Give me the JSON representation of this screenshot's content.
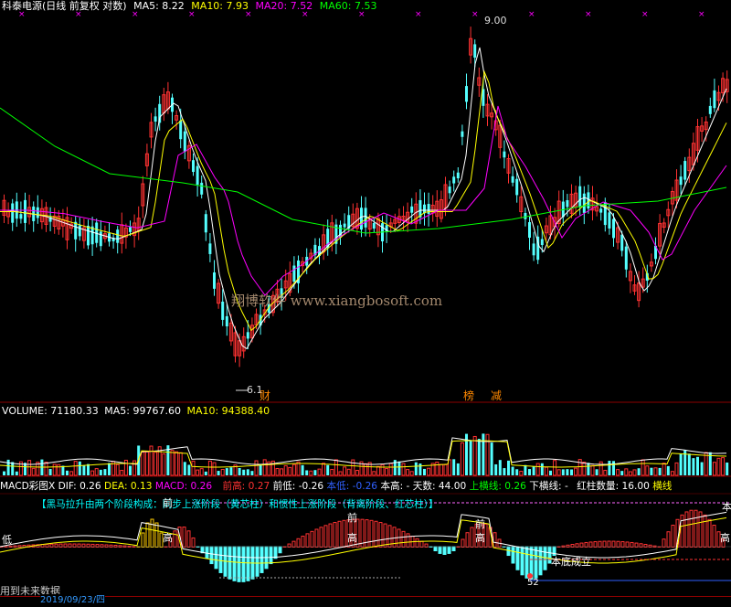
{
  "header": {
    "title": "科泰电源(日线 前复权 对数)",
    "ma5_label": "MA5: 8.22",
    "ma10_label": "MA10: 7.93",
    "ma20_label": "MA20: 7.52",
    "ma60_label": "MA60: 7.53",
    "high_price_label": "9.00",
    "low_price_label": "6.1",
    "badge_cai": "财",
    "badge_bang": "榜",
    "badge_jian": "减",
    "watermark": "翔博软件 www.xiangbosoft.com"
  },
  "volume_panel": {
    "volume_label": "VOLUME: 71180.33",
    "ma5_label": "MA5: 99767.60",
    "ma10_label": "MA10: 94388.40"
  },
  "macd_panel": {
    "name": "MACD彩图X",
    "dif": "DIF: 0.26",
    "dea": "DEA: 0.13",
    "macd": "MACD: 0.26",
    "qian_gao": "前高: 0.27",
    "qian_di": "前低: -0.26",
    "ben_di": "本低: -0.26",
    "ben_gao_days": "本高: - 天数: 44.00",
    "shang_heng": "上横线: 0.26",
    "xia_heng": "下横线: -",
    "hong_zhu": "红柱数量: 16.00",
    "heng_xian": "横线",
    "description": "【黑马拉升由两个阶段构成：同步上涨阶段（黄芯柱）和惯性上涨阶段（背离阶段、红芯柱）】",
    "label_gao1": "高",
    "label_gao2": "高",
    "label_gao3": "高",
    "label_gao4": "高",
    "label_qian1": "前",
    "label_qian2": "前",
    "label_qian3": "前",
    "label_ben": "本",
    "label_di": "低",
    "label_ben_di_cheng_li": "本底成立",
    "label_52": "52"
  },
  "footer": {
    "future_data": "用到未来数据",
    "date": "2019/09/23/四"
  },
  "colors": {
    "up": "#ff3232",
    "down": "#54ffff",
    "ma5": "#ffffff",
    "ma10": "#ffff00",
    "ma20": "#ff00ff",
    "ma60": "#00ff00",
    "grid_red": "#8b0000"
  }
}
